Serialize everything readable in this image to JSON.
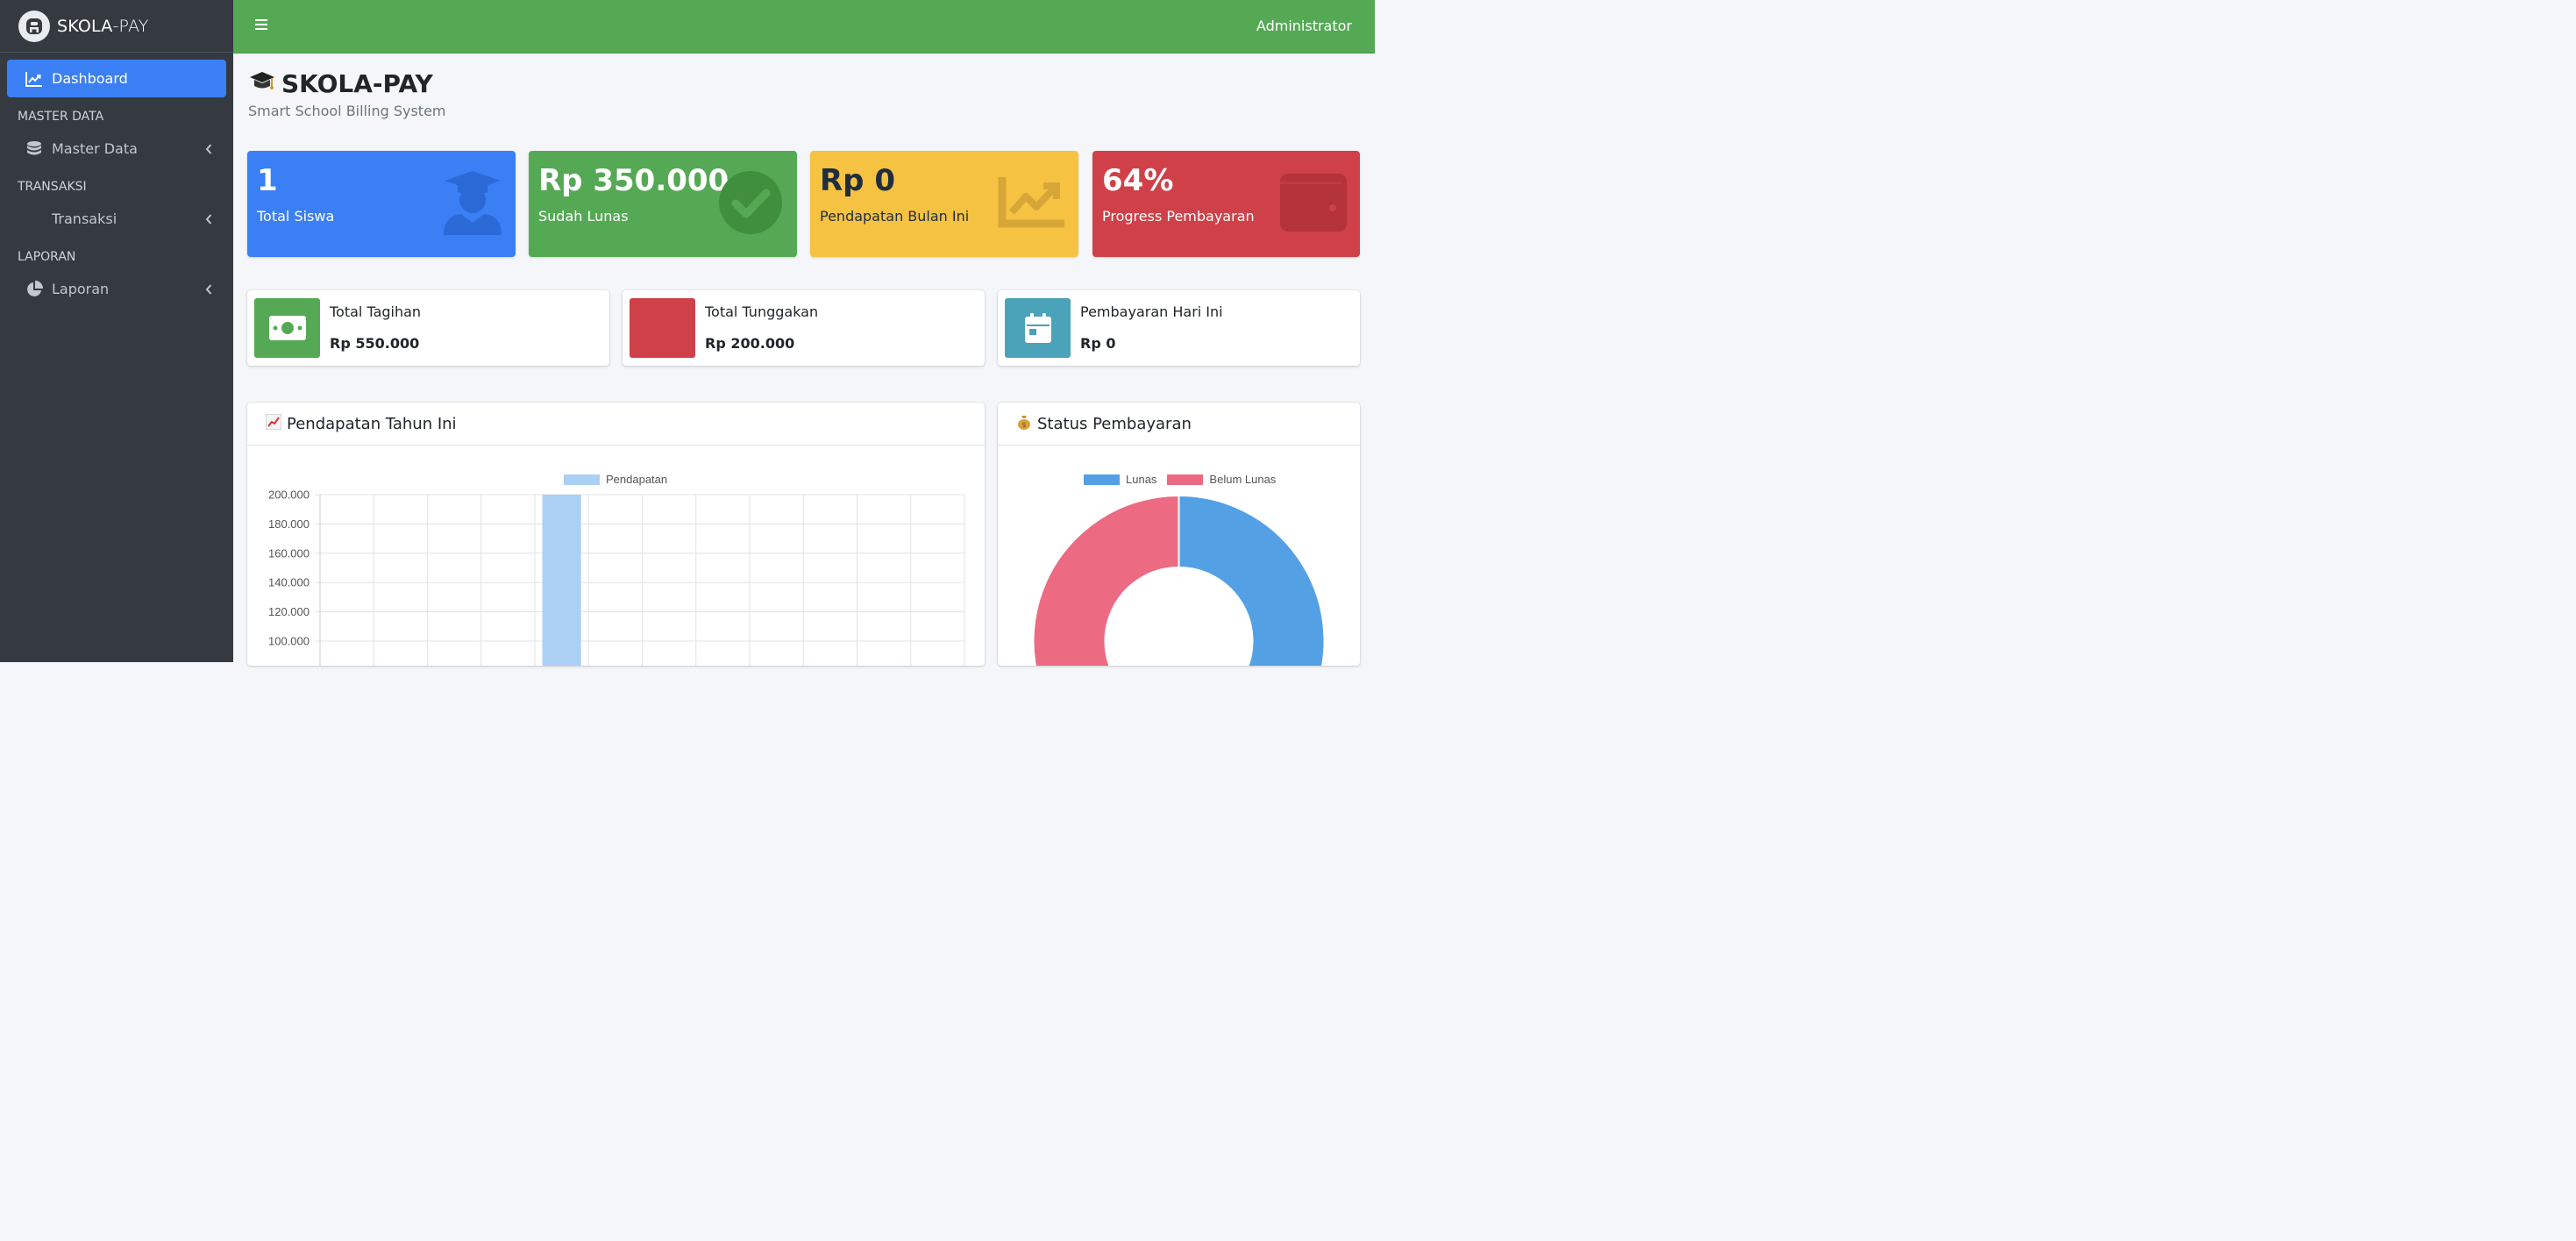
{
  "brand": {
    "name_main": "SKOLA",
    "name_suffix": "-PAY"
  },
  "sidebar": {
    "dashboard": "Dashboard",
    "header_master": "MASTER DATA",
    "master": "Master Data",
    "header_transaksi": "TRANSAKSI",
    "transaksi": "Transaksi",
    "header_laporan": "LAPORAN",
    "laporan": "Laporan"
  },
  "topbar": {
    "user": "Administrator"
  },
  "page": {
    "title": "SKOLA-PAY",
    "subtitle": "Smart School Billing System"
  },
  "stats": [
    {
      "value": "1",
      "label": "Total Siswa"
    },
    {
      "value": "Rp 350.000",
      "label": "Sudah Lunas"
    },
    {
      "value": "Rp 0",
      "label": "Pendapatan Bulan Ini"
    },
    {
      "value": "64%",
      "label": "Progress Pembayaran"
    }
  ],
  "info": [
    {
      "label": "Total Tagihan",
      "value": "Rp 550.000"
    },
    {
      "label": "Total Tunggakan",
      "value": "Rp 200.000"
    },
    {
      "label": "Pembayaran Hari Ini",
      "value": "Rp 0"
    }
  ],
  "cards": {
    "revenue_title": "Pendapatan Tahun Ini",
    "status_title": "Status Pembayaran"
  },
  "chart_data": [
    {
      "type": "bar",
      "series": [
        {
          "name": "Pendapatan",
          "values": [
            0,
            0,
            0,
            0,
            350000,
            0,
            0,
            0,
            0,
            0,
            0,
            0
          ]
        }
      ],
      "y_ticks": [
        "200.000",
        "180.000",
        "160.000",
        "140.000",
        "120.000",
        "100.000"
      ],
      "ylim_visible": [
        100000,
        200000
      ],
      "color": "#abd0f3",
      "grid": true,
      "legend": "top"
    },
    {
      "type": "pie",
      "variant": "doughnut",
      "labels": [
        "Lunas",
        "Belum Lunas"
      ],
      "values": [
        350000,
        200000
      ],
      "colors": [
        "#54a0e5",
        "#ec6b82"
      ],
      "legend": "top"
    }
  ]
}
